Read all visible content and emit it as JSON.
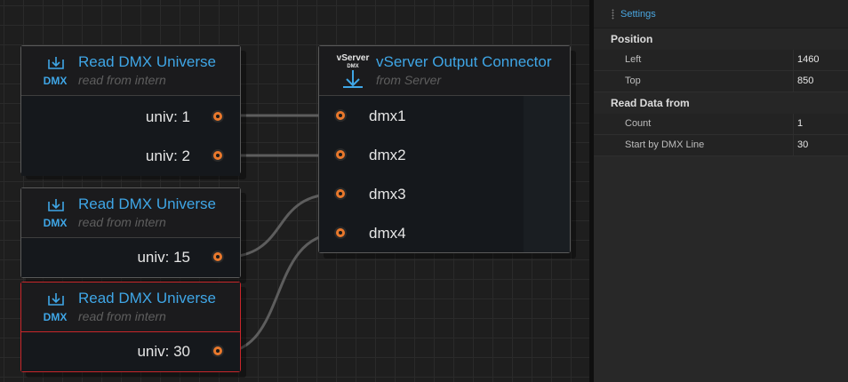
{
  "canvas": {
    "nodes": [
      {
        "id": "read1",
        "icon": "dmx-read-icon",
        "icon_text": "DMX",
        "title": "Read DMX Universe",
        "subtitle": "read from intern",
        "outputs": [
          "univ: 1",
          "univ: 2"
        ],
        "selected": false
      },
      {
        "id": "read2",
        "icon": "dmx-read-icon",
        "icon_text": "DMX",
        "title": "Read DMX Universe",
        "subtitle": "read from intern",
        "outputs": [
          "univ: 15"
        ],
        "selected": false
      },
      {
        "id": "read3",
        "icon": "dmx-read-icon",
        "icon_text": "DMX",
        "title": "Read DMX Universe",
        "subtitle": "read from intern",
        "outputs": [
          "univ: 30"
        ],
        "selected": true
      },
      {
        "id": "vserver",
        "icon": "vserver-icon",
        "icon_text_top": "vServer",
        "icon_text_bottom": "DMX",
        "title": "vServer Output Connector",
        "subtitle": "from Server",
        "inputs": [
          "dmx1",
          "dmx2",
          "dmx3",
          "dmx4"
        ],
        "selected": false
      }
    ],
    "connections": [
      {
        "from": "univ: 1",
        "to": "dmx1"
      },
      {
        "from": "univ: 2",
        "to": "dmx2"
      },
      {
        "from": "univ: 15",
        "to": "dmx3"
      },
      {
        "from": "univ: 30",
        "to": "dmx4"
      }
    ],
    "colors": {
      "title": "#3fa6e6",
      "port": "#e9782c",
      "selected_border": "#c8262a",
      "wire": "#5d5d5d"
    }
  },
  "panel": {
    "tab_label": "Settings",
    "sections": [
      {
        "title": "Position",
        "rows": [
          {
            "name": "Left",
            "value": "1460"
          },
          {
            "name": "Top",
            "value": "850"
          }
        ]
      },
      {
        "title": "Read Data from",
        "rows": [
          {
            "name": "Count",
            "value": "1"
          },
          {
            "name": "Start by DMX Line",
            "value": "30"
          }
        ]
      }
    ]
  }
}
